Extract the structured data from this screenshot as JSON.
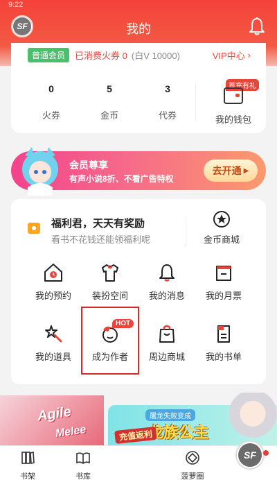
{
  "header": {
    "status_time": "9:22",
    "title": "我的",
    "logo_text": "SF",
    "bell_icon": "bell-icon",
    "gradient_color": "#f5423a"
  },
  "vip": {
    "level_badge": "普通会员",
    "spent_text": "已消费火券 0",
    "bai_v_text": "(白V 10000)",
    "center_label": "VIP中心",
    "center_chevron": "›",
    "stats": [
      {
        "value": "0",
        "label": "火券"
      },
      {
        "value": "5",
        "label": "金币"
      },
      {
        "value": "3",
        "label": "代券"
      }
    ],
    "wallet": {
      "tag": "首充有礼",
      "label": "我的钱包",
      "icon": "wallet-icon"
    }
  },
  "banner": {
    "title": "会员尊享",
    "subtitle": "有声小说8折、不看广告特权",
    "button_label": "去开通",
    "button_arrow": "▶"
  },
  "welfare": {
    "title": "福利君，天天有奖励",
    "subtitle": "看书不花钱还能领福利呢",
    "coin_shop_label": "金币商城",
    "grid": [
      {
        "label": "我的预约",
        "icon": "house-clock-icon"
      },
      {
        "label": "装扮空间",
        "icon": "tshirt-icon"
      },
      {
        "label": "我的消息",
        "icon": "bell-icon"
      },
      {
        "label": "我的月票",
        "icon": "ticket-icon"
      },
      {
        "label": "我的道具",
        "icon": "magic-wand-icon"
      },
      {
        "label": "成为作者",
        "icon": "author-icon",
        "tag": "HOT"
      },
      {
        "label": "周边商城",
        "icon": "shopping-bag-icon"
      },
      {
        "label": "我的书单",
        "icon": "book-list-icon"
      }
    ]
  },
  "promos": {
    "left_text_1": "Agile",
    "left_text_2": "Melee",
    "right_tag": "屠龙失败变成",
    "right_title": "龙族公主",
    "gift_text": "充值返利"
  },
  "tabbar": {
    "items": [
      {
        "label": "书架",
        "icon": "bookshelf-icon"
      },
      {
        "label": "书库",
        "icon": "open-book-icon"
      },
      {
        "label": "菠萝圈",
        "icon": "pineapple-circle-icon"
      }
    ],
    "profile_text": "SF"
  }
}
